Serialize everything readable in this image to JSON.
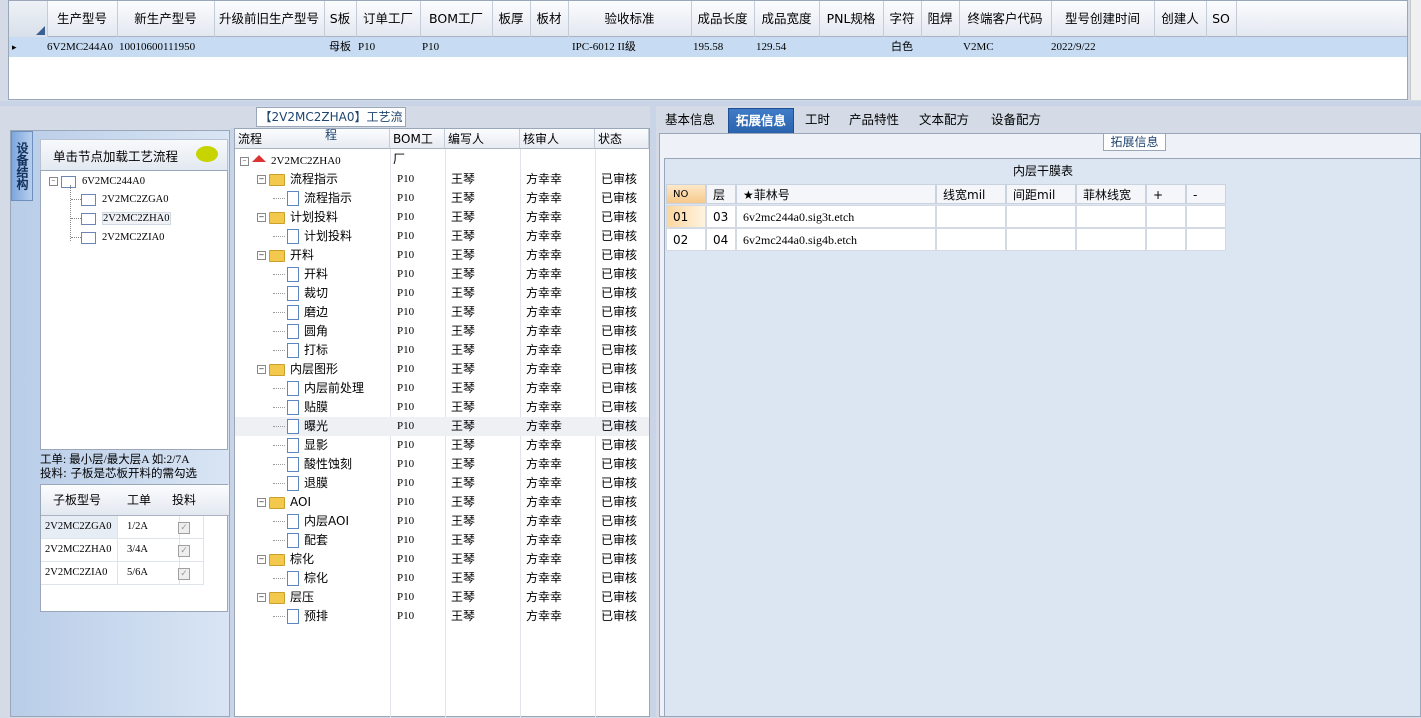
{
  "top_grid": {
    "columns": [
      "生产型号",
      "新生产型号",
      "升级前旧生产型号",
      "S板",
      "订单工厂",
      "BOM工厂",
      "板厚",
      "板材",
      "验收标准",
      "成品长度",
      "成品宽度",
      "PNL规格",
      "字符",
      "阻焊",
      "终端客户代码",
      "型号创建时间",
      "创建人",
      "SO"
    ],
    "row": [
      "6V2MC244A0",
      "10010600111950",
      "",
      "母板",
      "P10",
      "P10",
      "",
      "",
      "IPC-6012 II级",
      "195.58",
      "129.54",
      "",
      "白色",
      "",
      "V2MC",
      "2022/9/22",
      "",
      ""
    ],
    "row_indicator": "▸"
  },
  "left_panel": {
    "vertical_tab": "设备结构",
    "load_hint": "单击节点加载工艺流程",
    "tree": [
      {
        "label": "6V2MC244A0",
        "expander": "⊟"
      },
      {
        "label": "2V2MC2ZGA0"
      },
      {
        "label": "2V2MC2ZHA0"
      },
      {
        "label": "2V2MC2ZIA0"
      }
    ],
    "hint_line1": "工单: 最小层/最大层A 如:2/7A",
    "hint_line2": "投料: 子板是芯板开料的需勾选",
    "sub_table": {
      "columns": [
        "子板型号",
        "工单",
        "投料"
      ],
      "rows": [
        {
          "model": "2V2MC2ZGA0",
          "order": "1/2A"
        },
        {
          "model": "2V2MC2ZHA0",
          "order": "3/4A"
        },
        {
          "model": "2V2MC2ZIA0",
          "order": "5/6A"
        }
      ],
      "check_glyph": "✓"
    }
  },
  "process": {
    "title": "【2V2MC2ZHA0】工艺流程",
    "columns": [
      "流程",
      "BOM工厂",
      "编写人",
      "核审人",
      "状态"
    ],
    "root": "2V2MC2ZHA0",
    "rows": [
      {
        "name": "流程指示",
        "folder": true
      },
      {
        "name": "流程指示"
      },
      {
        "name": "计划投料",
        "folder": true
      },
      {
        "name": "计划投料"
      },
      {
        "name": "开料",
        "folder": true
      },
      {
        "name": "开料"
      },
      {
        "name": "裁切"
      },
      {
        "name": "磨边"
      },
      {
        "name": "圆角"
      },
      {
        "name": "打标"
      },
      {
        "name": "内层图形",
        "folder": true
      },
      {
        "name": "内层前处理"
      },
      {
        "name": "贴膜"
      },
      {
        "name": "曝光"
      },
      {
        "name": "显影"
      },
      {
        "name": "酸性蚀刻"
      },
      {
        "name": "退膜"
      },
      {
        "name": "AOI",
        "folder": true
      },
      {
        "name": "内层AOI"
      },
      {
        "name": "配套"
      },
      {
        "name": "棕化",
        "folder": true
      },
      {
        "name": "棕化"
      },
      {
        "name": "层压",
        "folder": true
      },
      {
        "name": "预排"
      }
    ],
    "bom_factory": "P10",
    "author": "王琴",
    "reviewer": "方幸幸",
    "status": "已审核"
  },
  "right": {
    "tabs": [
      "基本信息",
      "拓展信息",
      "工时",
      "产品特性",
      "文本配方",
      "设备配方"
    ],
    "active_tab": "拓展信息",
    "section_badge": "拓展信息",
    "table_title": "内层干膜表",
    "columns": [
      "NO",
      "层",
      "★菲林号",
      "线宽mil",
      "间距mil",
      "菲林线宽",
      "+",
      "-"
    ],
    "rows": [
      {
        "no": "01",
        "layer": "03",
        "film": "6v2mc244a0.sig3t.etch"
      },
      {
        "no": "02",
        "layer": "04",
        "film": "6v2mc244a0.sig4b.etch"
      }
    ]
  },
  "colors": {
    "accent": "#2a62ad",
    "selection": "#c7dbf2",
    "folder": "#f2c94c"
  }
}
